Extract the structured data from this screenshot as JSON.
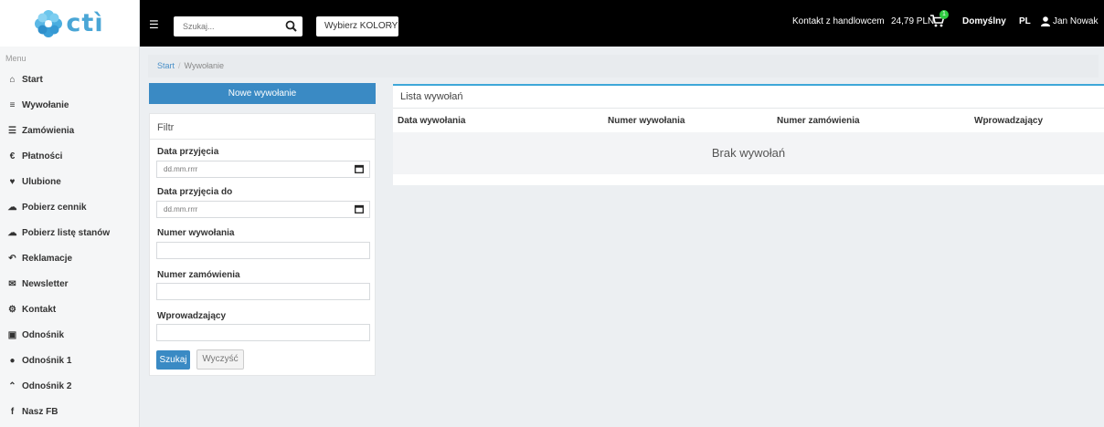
{
  "brand": {
    "logo_text": "ctì"
  },
  "sidebar": {
    "caption": "Menu",
    "items": [
      {
        "label": "Start",
        "icon": "⌂"
      },
      {
        "label": "Wywołanie",
        "icon": "≡"
      },
      {
        "label": "Zamówienia",
        "icon": "☰"
      },
      {
        "label": "Płatności",
        "icon": "€"
      },
      {
        "label": "Ulubione",
        "icon": "♥"
      },
      {
        "label": "Pobierz cennik",
        "icon": "☁"
      },
      {
        "label": "Pobierz listę stanów",
        "icon": "☁"
      },
      {
        "label": "Reklamacje",
        "icon": "↶"
      },
      {
        "label": "Newsletter",
        "icon": "✉"
      },
      {
        "label": "Kontakt",
        "icon": "⚙"
      },
      {
        "label": "Odnośnik",
        "icon": "▣"
      },
      {
        "label": "Odnośnik 1",
        "icon": "●"
      },
      {
        "label": "Odnośnik 2",
        "icon": "⌃"
      },
      {
        "label": "Nasz FB",
        "icon": "f"
      }
    ]
  },
  "topbar": {
    "search_placeholder": "Szukaj...",
    "color_select": "Wybierz KOLORY",
    "contact": "Kontakt z handlowcem",
    "price": "24,79 PLN",
    "cart_count": "1",
    "profile": "Domyślny",
    "lang": "PL",
    "user": "Jan Nowak"
  },
  "breadcrumb": {
    "home": "Start",
    "current": "Wywołanie"
  },
  "new_button": "Nowe wywołanie",
  "filter": {
    "title": "Filtr",
    "date_from_label": "Data przyjęcia",
    "date_from_placeholder": "dd.mm.rrrr",
    "date_to_label": "Data przyjęcia do",
    "date_to_placeholder": "dd.mm.rrrr",
    "call_number_label": "Numer wywołania",
    "order_number_label": "Numer zamówienia",
    "entered_by_label": "Wprowadzający",
    "search_button": "Szukaj",
    "clear_button": "Wyczyść"
  },
  "list": {
    "title": "Lista wywołań",
    "columns": [
      "Data wywołania",
      "Numer wywołania",
      "Numer zamówienia",
      "Wprowadzający"
    ],
    "empty_text": "Brak wywołań"
  },
  "colors": {
    "accent": "#3a8ac4",
    "topbar": "#000000",
    "logo": "#4aa6d6"
  }
}
